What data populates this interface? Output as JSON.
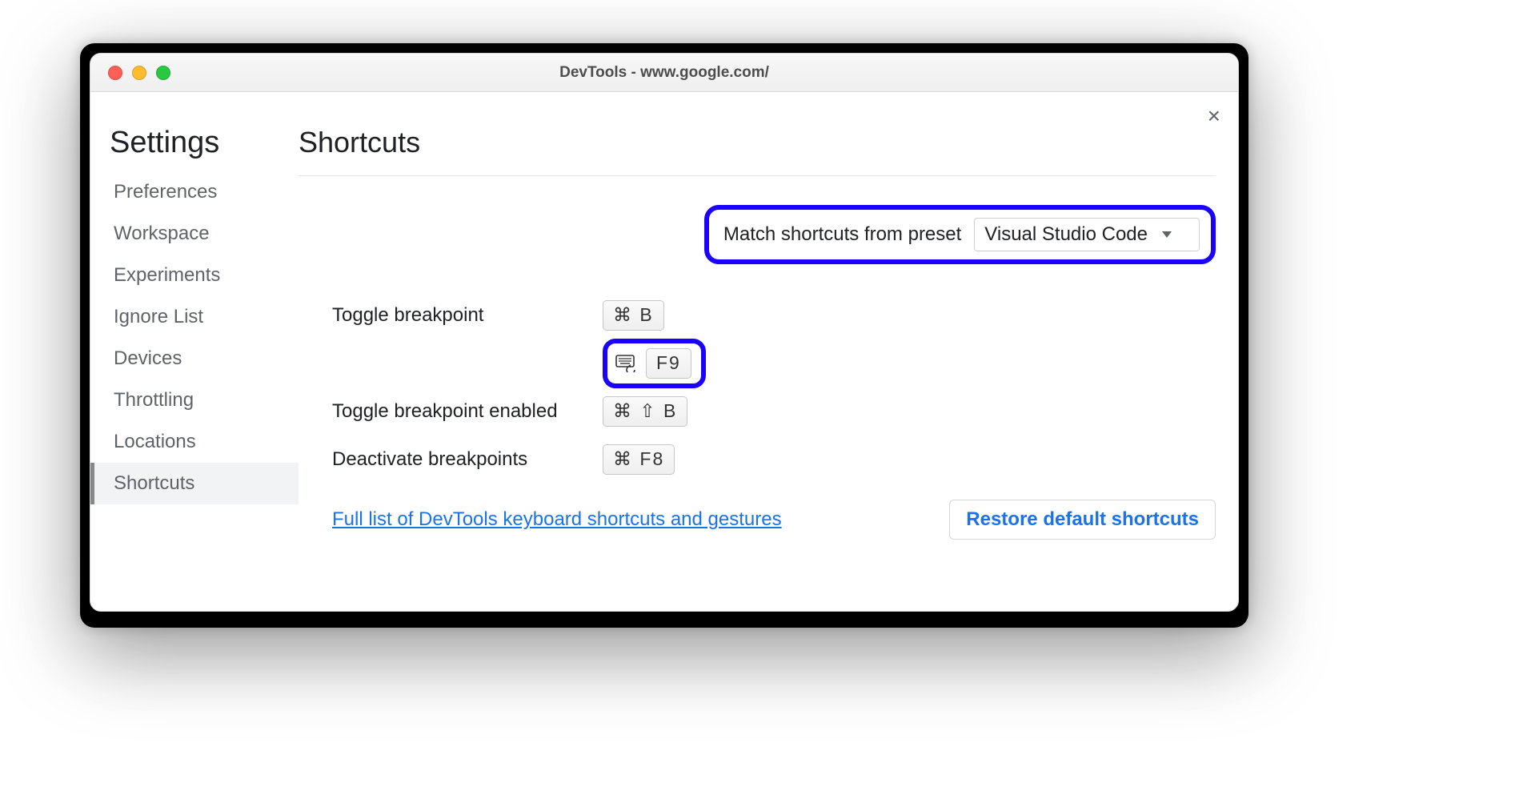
{
  "window": {
    "title": "DevTools - www.google.com/"
  },
  "sidebar": {
    "title": "Settings",
    "items": [
      {
        "label": "Preferences",
        "active": false
      },
      {
        "label": "Workspace",
        "active": false
      },
      {
        "label": "Experiments",
        "active": false
      },
      {
        "label": "Ignore List",
        "active": false
      },
      {
        "label": "Devices",
        "active": false
      },
      {
        "label": "Throttling",
        "active": false
      },
      {
        "label": "Locations",
        "active": false
      },
      {
        "label": "Shortcuts",
        "active": true
      }
    ]
  },
  "panel": {
    "title": "Shortcuts",
    "preset_label": "Match shortcuts from preset",
    "preset_value": "Visual Studio Code",
    "shortcuts": [
      {
        "label": "Toggle breakpoint",
        "keys": "⌘ B"
      },
      {
        "label": "",
        "keys": "F9",
        "highlighted": true,
        "has_reset_icon": true
      },
      {
        "label": "Toggle breakpoint enabled",
        "keys": "⌘ ⇧ B"
      },
      {
        "label": "Deactivate breakpoints",
        "keys": "⌘ F8"
      }
    ],
    "doc_link": "Full list of DevTools keyboard shortcuts and gestures",
    "restore_label": "Restore default shortcuts"
  },
  "highlight_color": "#1a00ff",
  "link_color": "#1a73e8"
}
